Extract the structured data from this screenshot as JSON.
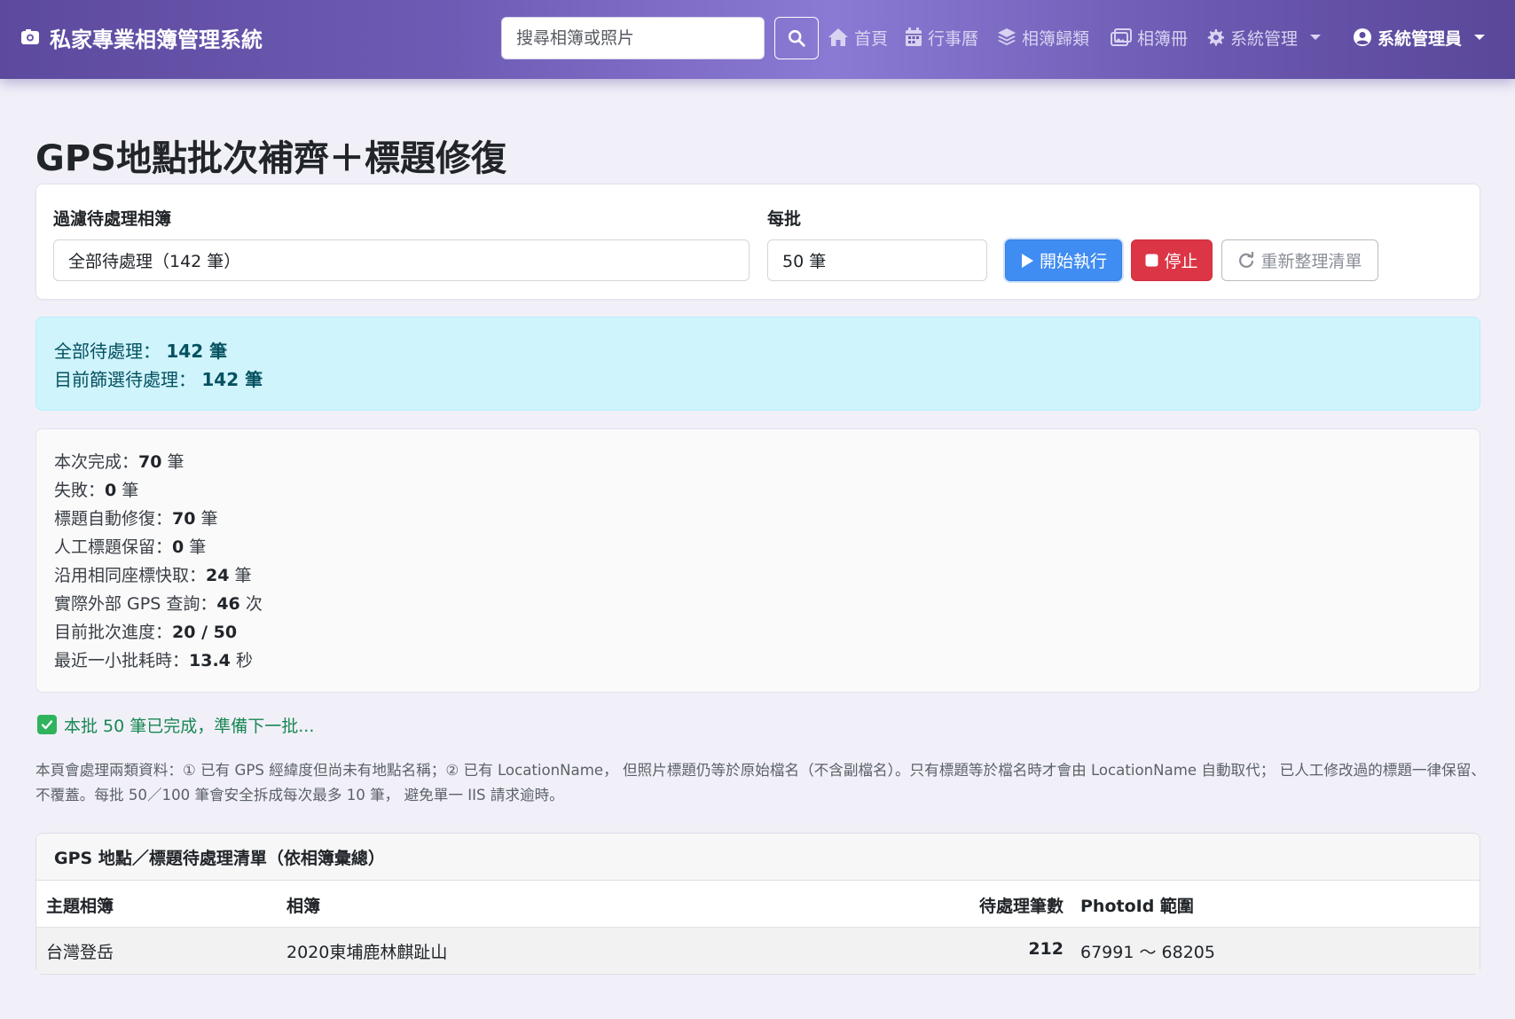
{
  "navbar": {
    "brand": "私家專業相簿管理系統",
    "search_placeholder": "搜尋相簿或照片",
    "links": [
      {
        "label": "首頁",
        "icon": "home-icon"
      },
      {
        "label": "行事曆",
        "icon": "calendar-icon"
      },
      {
        "label": "相簿歸類",
        "icon": "layers-icon"
      },
      {
        "label": "相簿冊",
        "icon": "images-icon"
      },
      {
        "label": "系統管理",
        "icon": "gear-icon"
      }
    ],
    "user": "系統管理員"
  },
  "page": {
    "title": "GPS地點批次補齊＋標題修復"
  },
  "filter": {
    "album_label": "過濾待處理相簿",
    "album_value": "全部待處理（142 筆）",
    "batch_label": "每批",
    "batch_value": "50 筆",
    "start_label": "開始執行",
    "stop_label": "停止",
    "refresh_label": "重新整理清單"
  },
  "summary": {
    "total_label": "全部待處理：",
    "total_value": "142 筆",
    "filtered_label": "目前篩選待處理：",
    "filtered_value": "142 筆"
  },
  "stats": [
    {
      "label": "本次完成：",
      "value": "70",
      "unit": " 筆"
    },
    {
      "label": "失敗：",
      "value": "0",
      "unit": " 筆"
    },
    {
      "label": "標題自動修復：",
      "value": "70",
      "unit": " 筆"
    },
    {
      "label": "人工標題保留：",
      "value": "0",
      "unit": " 筆"
    },
    {
      "label": "沿用相同座標快取：",
      "value": "24",
      "unit": " 筆"
    },
    {
      "label": "實際外部 GPS 查詢：",
      "value": "46",
      "unit": " 次"
    },
    {
      "label": "目前批次進度：",
      "value": "20 / 50",
      "unit": ""
    },
    {
      "label": "最近一小批耗時：",
      "value": "13.4",
      "unit": " 秒"
    }
  ],
  "status_message": "本批 50 筆已完成，準備下一批...",
  "help_text": "本頁會處理兩類資料：① 已有 GPS 經緯度但尚未有地點名稱；② 已有 LocationName， 但照片標題仍等於原始檔名（不含副檔名）。只有標題等於檔名時才會由 LocationName 自動取代； 已人工修改過的標題一律保留、不覆蓋。每批 50／100 筆會安全拆成每次最多 10 筆， 避免單一 IIS 請求逾時。",
  "table": {
    "title": "GPS 地點／標題待處理清單（依相簿彙總）",
    "columns": [
      "主題相簿",
      "相簿",
      "待處理筆數",
      "PhotoId 範圍"
    ],
    "rows": [
      [
        "台灣登岳",
        "2020東埔鹿林麒趾山",
        "212",
        "67991 ～ 68205"
      ]
    ]
  }
}
